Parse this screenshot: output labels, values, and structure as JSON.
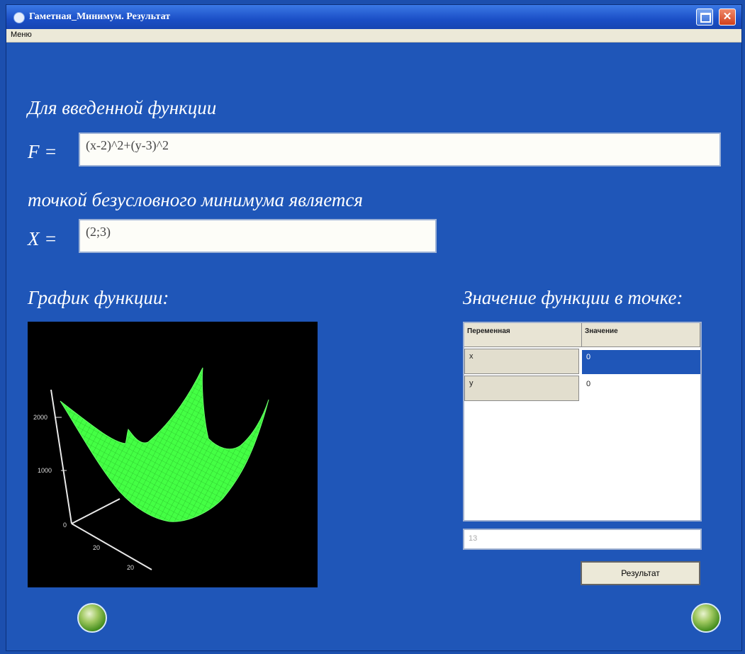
{
  "window": {
    "title": "Гаметная_Минимум. Результат",
    "menu_item": "Меню",
    "close_label": "✕"
  },
  "main": {
    "label_func": "Для введенной функции",
    "f_prefix": "F =",
    "function_value": "(x-2)^2+(y-3)^2",
    "label_min": "точкой безусловного минимума является",
    "x_prefix": "X =",
    "min_point_value": "(2;3)",
    "label_plot": "График функции:",
    "label_table": "Значение функции в точке:"
  },
  "plot": {
    "axis_tick_labels": [
      "2000",
      "1000",
      "0",
      "20",
      "20"
    ]
  },
  "table": {
    "headers": [
      "Переменная",
      "Значение"
    ],
    "rows": [
      {
        "var": "x",
        "value": "0"
      },
      {
        "var": "y",
        "value": "0"
      }
    ]
  },
  "bottom_input": {
    "value": "13"
  },
  "buttons": {
    "result_label": "Результат"
  },
  "colors": {
    "background": "#1f56b8",
    "surface": "#44ff44",
    "selection": "#1f56b8"
  }
}
